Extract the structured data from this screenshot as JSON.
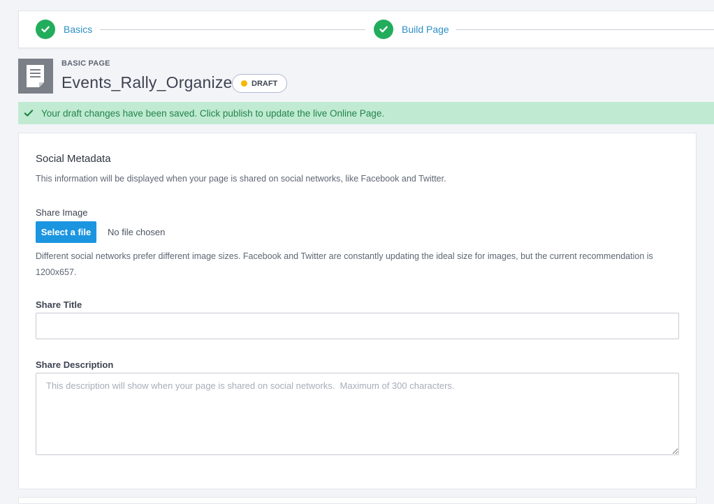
{
  "stepper": {
    "steps": [
      {
        "label": "Basics",
        "state": "complete"
      },
      {
        "label": "Build Page",
        "state": "complete"
      }
    ]
  },
  "page": {
    "eyebrow": "BASIC PAGE",
    "title": "Events_Rally_Organize",
    "status": "DRAFT",
    "doc_icon": "document-icon"
  },
  "alert": {
    "message": "Your draft changes have been saved. Click publish to update the live Online Page.",
    "icon": "checkmark-icon"
  },
  "social_metadata": {
    "title": "Social Metadata",
    "description": "This information will be displayed when your page is shared on social networks, like Facebook and Twitter.",
    "share_image": {
      "label": "Share Image",
      "button_label": "Select a file",
      "file_status": "No file chosen",
      "help_text": "Different social networks prefer different image sizes. Facebook and Twitter are constantly updating the ideal size for images, but the current recommendation is 1200x657."
    },
    "share_title": {
      "label": "Share Title",
      "value": ""
    },
    "share_description": {
      "label": "Share Description",
      "value": "",
      "placeholder": "This description will show when your page is shared on social networks.  Maximum of 300 characters."
    }
  },
  "colors": {
    "success": "#22ad5c",
    "link": "#2b8fc4",
    "primary_button": "#1c95e0",
    "draft_dot": "#f6b800",
    "alert_bg": "#c0ebd2",
    "alert_text": "#23834a"
  }
}
